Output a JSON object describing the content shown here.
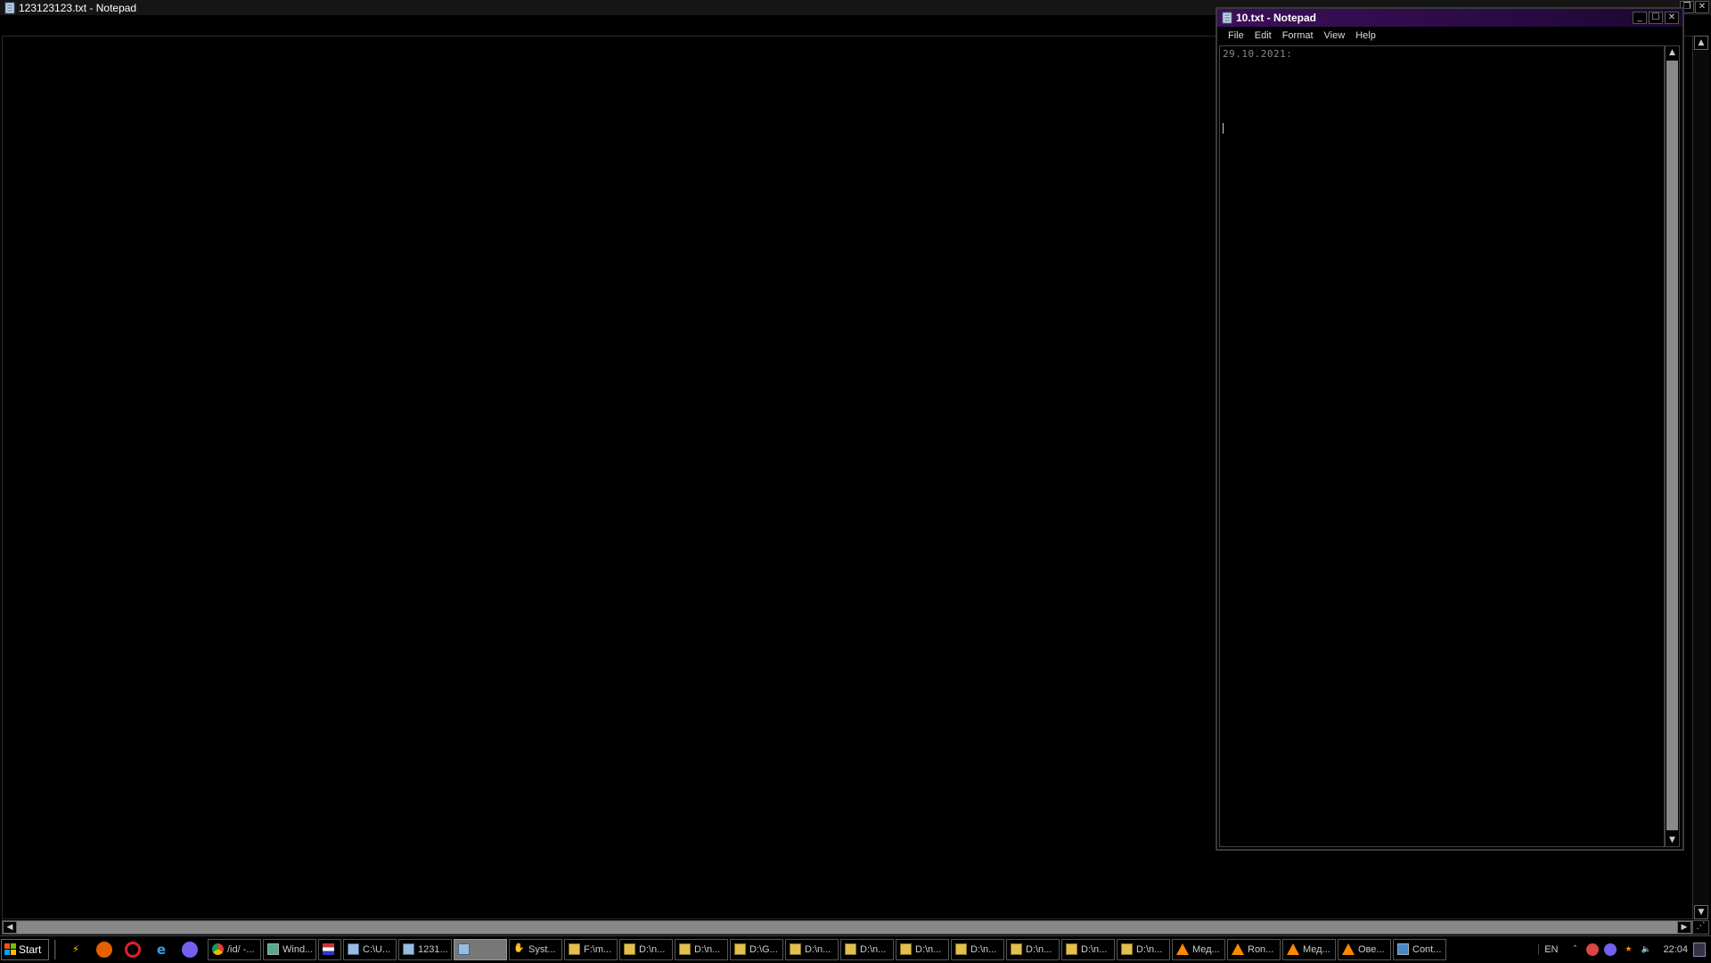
{
  "main_window": {
    "title": "123123123.txt - Notepad",
    "content": ""
  },
  "secondary_window": {
    "title": "10.txt - Notepad",
    "menu": [
      "File",
      "Edit",
      "Format",
      "View",
      "Help"
    ],
    "content": "29.10.2021:"
  },
  "taskbar": {
    "start_label": "Start",
    "quick_launch": [
      "lightning-icon",
      "firefox-icon",
      "opera-icon",
      "ie-icon",
      "viber-icon"
    ],
    "tasks": [
      {
        "label": "/id/ -...",
        "icon": "chrome-icon",
        "active": false
      },
      {
        "label": "Wind...",
        "icon": "window-icon",
        "active": false
      },
      {
        "label": "",
        "icon": "flag-icon",
        "active": false
      },
      {
        "label": "C:\\U...",
        "icon": "notepad-icon",
        "active": false
      },
      {
        "label": "1231...",
        "icon": "notepad-icon",
        "active": false
      },
      {
        "label": "",
        "icon": "notepad-icon",
        "active": true
      },
      {
        "label": "Syst...",
        "icon": "hand-icon",
        "active": false
      },
      {
        "label": "F:\\m...",
        "icon": "folder-icon",
        "active": false
      },
      {
        "label": "D:\\n...",
        "icon": "folder-icon",
        "active": false
      },
      {
        "label": "D:\\n...",
        "icon": "folder-icon",
        "active": false
      },
      {
        "label": "D:\\G...",
        "icon": "folder-icon",
        "active": false
      },
      {
        "label": "D:\\n...",
        "icon": "folder-icon",
        "active": false
      },
      {
        "label": "D:\\n...",
        "icon": "folder-icon",
        "active": false
      },
      {
        "label": "D:\\n...",
        "icon": "folder-icon",
        "active": false
      },
      {
        "label": "D:\\n...",
        "icon": "folder-icon",
        "active": false
      },
      {
        "label": "D:\\n...",
        "icon": "folder-icon",
        "active": false
      },
      {
        "label": "D:\\n...",
        "icon": "folder-icon",
        "active": false
      },
      {
        "label": "D:\\n...",
        "icon": "folder-icon",
        "active": false
      },
      {
        "label": "Мед...",
        "icon": "vlc-icon",
        "active": false
      },
      {
        "label": "Ron...",
        "icon": "vlc-icon",
        "active": false
      },
      {
        "label": "Мед...",
        "icon": "vlc-icon",
        "active": false
      },
      {
        "label": "Ове...",
        "icon": "vlc-icon",
        "active": false
      },
      {
        "label": "Cont...",
        "icon": "control-panel-icon",
        "active": false
      }
    ],
    "language": "EN",
    "clock": "22:04"
  }
}
